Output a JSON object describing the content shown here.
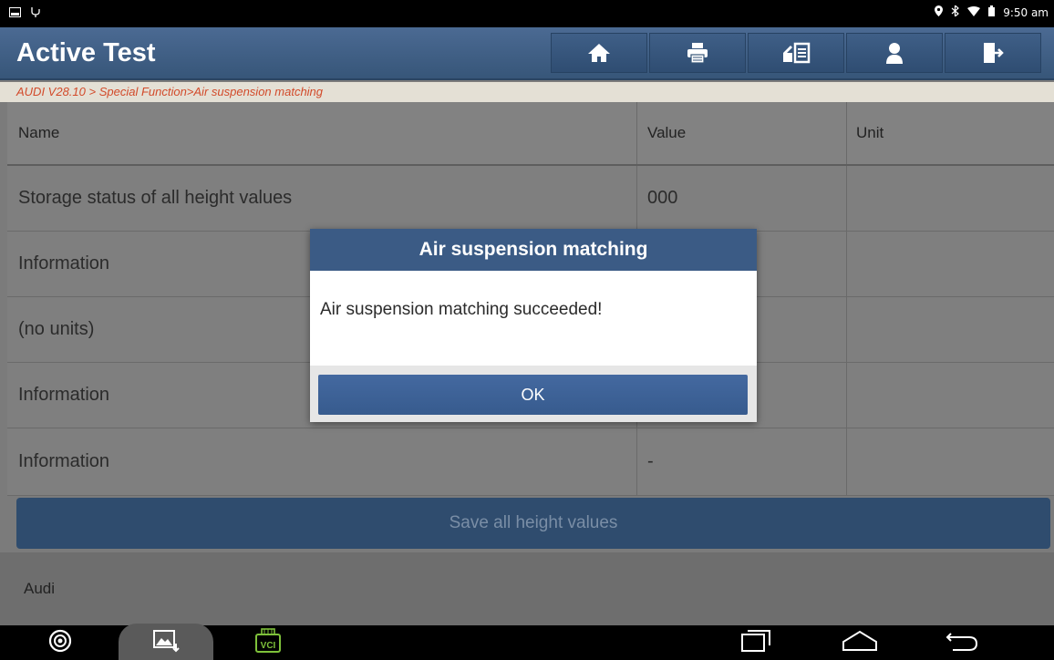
{
  "status_bar": {
    "time": "9:50 am"
  },
  "header": {
    "title": "Active Test",
    "toolbar": [
      "home-icon",
      "print-icon",
      "report-icon",
      "user-icon",
      "exit-icon"
    ]
  },
  "breadcrumb": "AUDI V28.10 > Special Function>Air suspension matching",
  "table": {
    "columns": {
      "name": "Name",
      "value": "Value",
      "unit": "Unit"
    },
    "rows": [
      {
        "name": "Storage status of all height values",
        "value": "000",
        "unit": ""
      },
      {
        "name": "Information",
        "value": "",
        "unit": ""
      },
      {
        "name": "(no units)",
        "value": "",
        "unit": ""
      },
      {
        "name": "Information",
        "value": "",
        "unit": ""
      },
      {
        "name": "Information",
        "value": "-",
        "unit": ""
      }
    ]
  },
  "save_button": "Save all height values",
  "footer": {
    "brand": "Audi"
  },
  "dialog": {
    "title": "Air suspension matching",
    "message": "Air suspension matching succeeded!",
    "ok_label": "OK"
  },
  "nav": {
    "vci_label": "VCI"
  },
  "colors": {
    "header_blue": "#3b5b85",
    "breadcrumb_text": "#d24a2a",
    "vci_green": "#7ec13a"
  }
}
